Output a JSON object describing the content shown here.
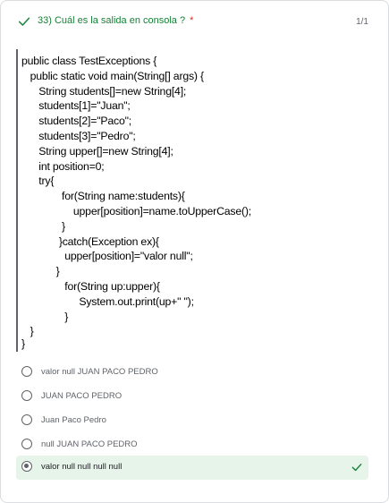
{
  "question": {
    "title": "33) Cuál es la salida en consola ?",
    "required_mark": "*",
    "score": "1/1",
    "status_icon": "check-icon",
    "status_color": "#188038"
  },
  "code": {
    "lines": [
      "public class TestExceptions {",
      "   public static void main(String[] args) {",
      "      String students[]=new String[4];",
      "      students[1]=\"Juan\";",
      "      students[2]=\"Paco\";",
      "      students[3]=\"Pedro\";",
      "      String upper[]=new String[4];",
      "      int position=0;",
      "      try{",
      "              for(String name:students){",
      "                  upper[position]=name.toUpperCase();",
      "              }",
      "             }catch(Exception ex){",
      "               upper[position]=\"valor null\";",
      "            }",
      "               for(String up:upper){",
      "                    System.out.print(up+\" \");",
      "               }",
      "   }",
      "}"
    ]
  },
  "options": [
    {
      "label": "valor null JUAN PACO PEDRO",
      "selected": false
    },
    {
      "label": "JUAN PACO PEDRO",
      "selected": false
    },
    {
      "label": "Juan Paco Pedro",
      "selected": false
    },
    {
      "label": "null JUAN PACO PEDRO",
      "selected": false
    },
    {
      "label": "valor null null null null",
      "selected": true,
      "correct": true
    }
  ],
  "colors": {
    "correct_green": "#188038",
    "selected_bg": "#e6f4ea",
    "required_red": "#d93025"
  }
}
